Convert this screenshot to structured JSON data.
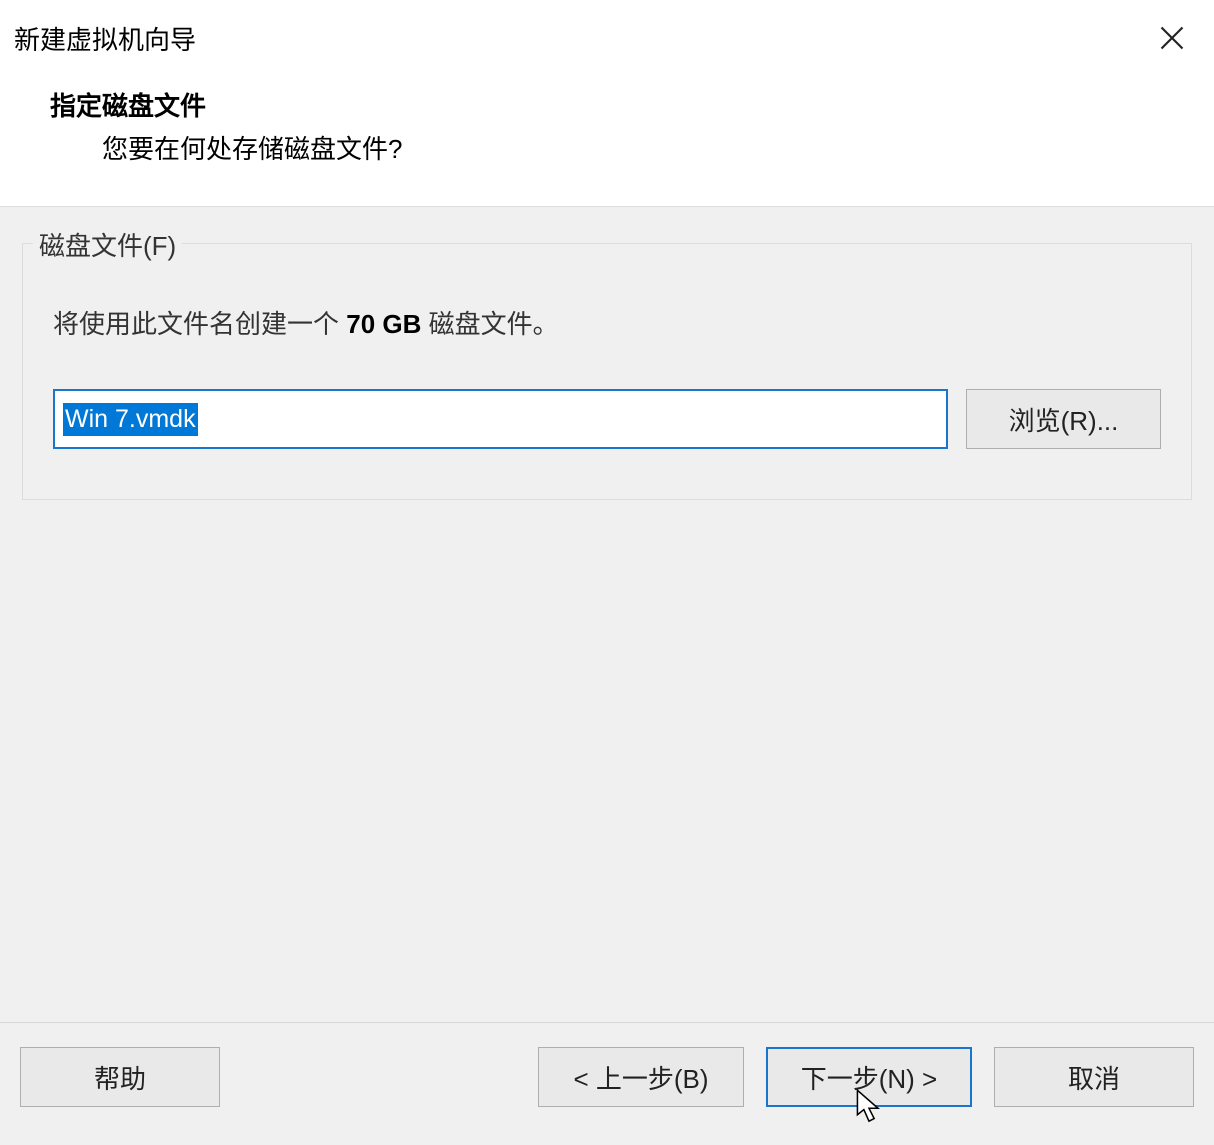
{
  "window": {
    "title": "新建虚拟机向导"
  },
  "header": {
    "step_title": "指定磁盘文件",
    "step_question": "您要在何处存储磁盘文件?"
  },
  "fieldset": {
    "legend": "磁盘文件(F)",
    "desc_prefix": "将使用此文件名创建一个 ",
    "desc_size": "70 GB",
    "desc_suffix": " 磁盘文件。",
    "input_value": "Win 7.vmdk",
    "browse_label": "浏览(R)..."
  },
  "footer": {
    "help": "帮助",
    "back": "< 上一步(B)",
    "next": "下一步(N) >",
    "cancel": "取消"
  }
}
